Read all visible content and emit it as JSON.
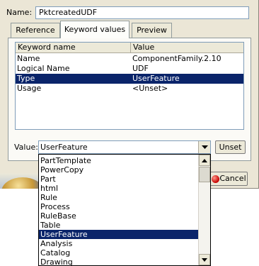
{
  "name_field": {
    "label": "Name:",
    "value": "PktcreatedUDF"
  },
  "tabs": [
    {
      "label": "Reference",
      "active": false
    },
    {
      "label": "Keyword values",
      "active": true
    },
    {
      "label": "Preview",
      "active": false
    }
  ],
  "keyword_table": {
    "columns": [
      "Keyword name",
      "Value"
    ],
    "rows": [
      {
        "keyword": "Name",
        "value": "ComponentFamily.2.10",
        "selected": false
      },
      {
        "keyword": "Logical Name",
        "value": "UDF",
        "selected": false
      },
      {
        "keyword": "Type",
        "value": "UserFeature",
        "selected": true
      },
      {
        "keyword": "Usage",
        "value": "<Unset>",
        "selected": false
      }
    ]
  },
  "value_field": {
    "label": "Value:",
    "selected": "UserFeature"
  },
  "buttons": {
    "unset": "Unset",
    "cancel": "Cancel"
  },
  "dropdown_options": [
    "PartTemplate",
    "PowerCopy",
    "Part",
    "html",
    "Rule",
    "Process",
    "RuleBase",
    "Table",
    "UserFeature",
    "Analysis",
    "Catalog",
    "Drawing"
  ],
  "dropdown_selected_index": 8,
  "icons": [
    "chevron-down-icon",
    "chevron-up-icon",
    "cancel-icon",
    "planet-icon"
  ],
  "colors": {
    "selection": "#0a246a",
    "dialog_bg": "#ebe6d6"
  }
}
